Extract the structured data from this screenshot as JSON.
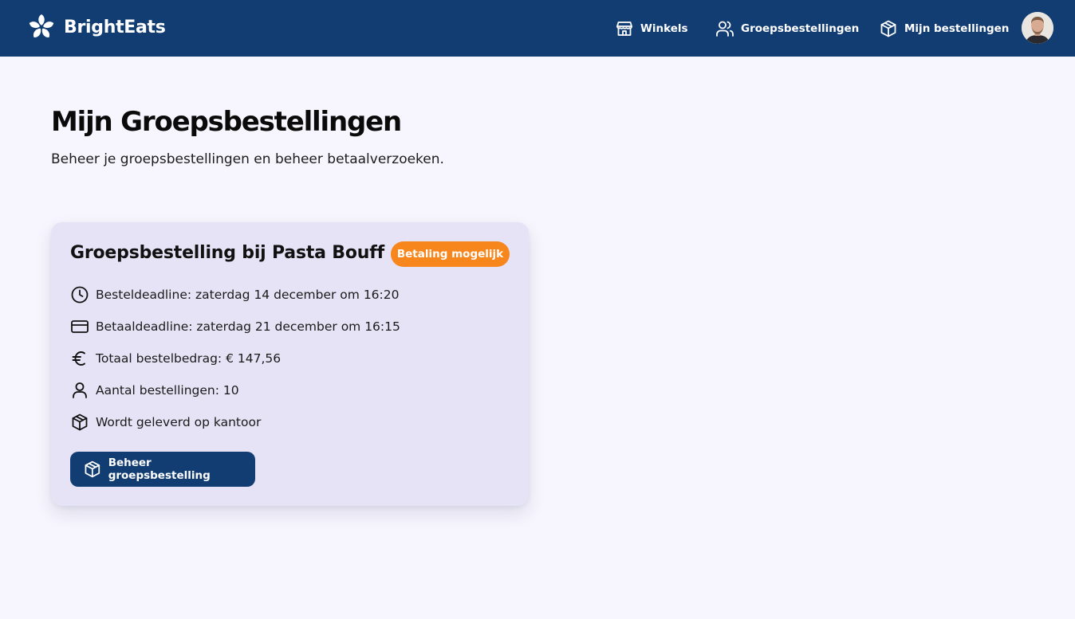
{
  "header": {
    "brand_name": "BrightEats",
    "nav": {
      "winkels": "Winkels",
      "groepsbestellingen": "Groepsbestellingen",
      "mijn_bestellingen": "Mijn bestellingen"
    },
    "icons": {
      "logo": "flower-logo-icon",
      "winkels": "store-icon",
      "groepsbestellingen": "users-icon",
      "mijn_bestellingen": "package-icon"
    }
  },
  "page": {
    "title": "Mijn Groepsbestellingen",
    "subtitle": "Beheer je groepsbestellingen en beheer betaalverzoeken."
  },
  "card": {
    "title": "Groepsbestelling bij Pasta Bouff",
    "badge": "Betaling mogelijk",
    "rows": [
      {
        "icon": "clock-icon",
        "text": "Besteldeadline: zaterdag 14 december om 16:20"
      },
      {
        "icon": "credit-card-icon",
        "text": "Betaaldeadline: zaterdag 21 december om 16:15"
      },
      {
        "icon": "euro-icon",
        "text": "Totaal bestelbedrag: € 147,56"
      },
      {
        "icon": "user-icon",
        "text": "Aantal bestellingen: 10"
      },
      {
        "icon": "package-icon",
        "text": "Wordt geleverd op kantoor"
      }
    ],
    "button": {
      "icon": "package-icon",
      "label": "Beheer groepsbestelling"
    }
  },
  "colors": {
    "header_bg": "#123d73",
    "page_bg": "#f7f6fe",
    "card_bg": "#e5e3f5",
    "badge_bg": "#f7861c",
    "button_bg": "#123d73"
  }
}
